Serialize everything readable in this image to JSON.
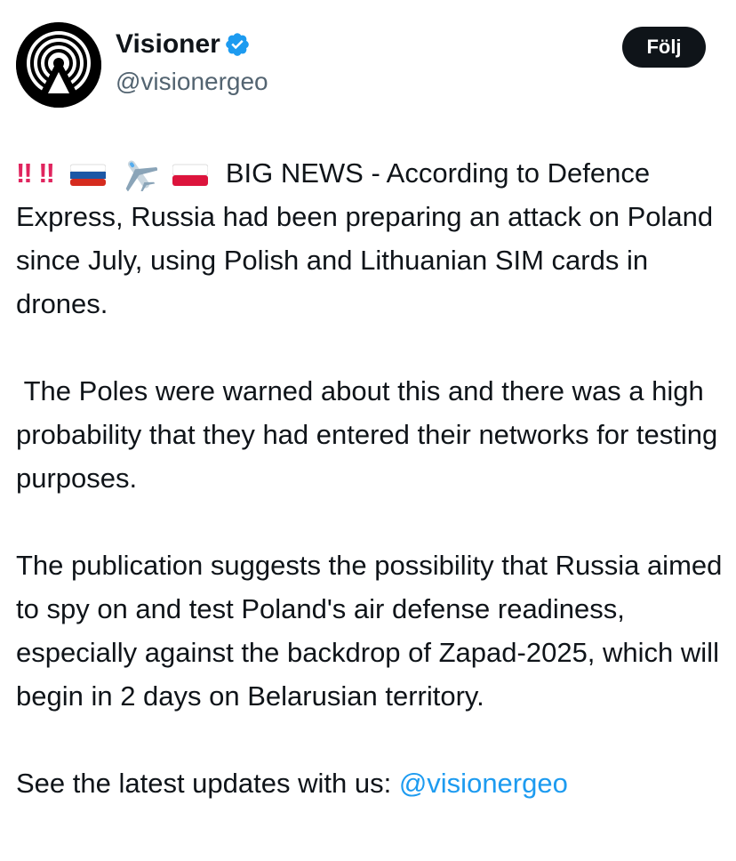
{
  "author": {
    "display_name": "Visioner",
    "handle": "@visionergeo",
    "verified": true,
    "avatar_icon": "radio-tower-icon"
  },
  "follow_button": {
    "label": "Följ"
  },
  "tweet": {
    "lead_emojis": [
      "double-exclamation-icon",
      "double-exclamation-icon",
      "russia-flag-icon",
      "airplane-icon",
      "poland-flag-icon"
    ],
    "p1": "BIG NEWS - According to Defence Express, Russia had been preparing an attack on Poland since July, using Polish and Lithuanian SIM cards in drones.",
    "p2": "The Poles were warned about this and there was a high probability that they had entered their networks for testing purposes.",
    "p3": "The publication suggests the possibility that Russia aimed to spy on and test Poland's air defense readiness, especially against the backdrop of Zapad-2025, which will begin in 2 days on Belarusian territory.",
    "p4_text": "See the latest updates with us: ",
    "p4_mention": "@visionergeo"
  },
  "colors": {
    "text": "#0f1419",
    "secondary": "#536471",
    "link": "#1d9bf0",
    "verified": "#1d9bf0",
    "button_bg": "#0f1419",
    "exclamation": "#e0245e"
  }
}
